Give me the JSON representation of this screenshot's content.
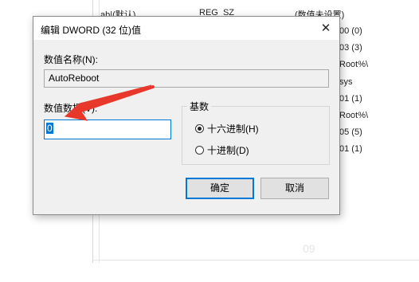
{
  "background": {
    "rows": [
      {
        "col1": "ab|(默认)",
        "col2": "REG_SZ",
        "col3": "(数值未设置)"
      },
      {
        "col3": "00 (0)"
      },
      {
        "col3": "03 (3)"
      },
      {
        "col3": "Root%\\"
      },
      {
        "col3": "sys"
      },
      {
        "col3": "01 (1)"
      },
      {
        "col3": "Root%\\"
      },
      {
        "col3": "05 (5)"
      },
      {
        "col3": "01 (1)"
      }
    ],
    "watermark": "09"
  },
  "dialog": {
    "title": "编辑 DWORD (32 位)值",
    "close_glyph": "✕",
    "name_label": "数值名称(N):",
    "name_value": "AutoReboot",
    "data_label": "数值数据(V):",
    "data_value": "0",
    "base_label": "基数",
    "radio_hex": "十六进制(H)",
    "radio_dec": "十进制(D)",
    "selected_base": "hex",
    "ok_label": "确定",
    "cancel_label": "取消"
  },
  "annotation": {
    "arrow_color": "#e8372b"
  },
  "colors": {
    "accent": "#0078d7",
    "dialog_bg": "#f0f0f0"
  }
}
